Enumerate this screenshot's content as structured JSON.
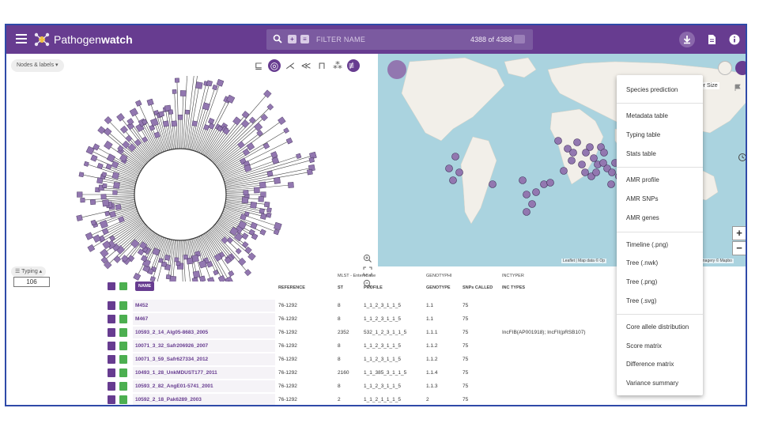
{
  "app": {
    "title_prefix": "Pathogen",
    "title_suffix": "watch"
  },
  "search": {
    "placeholder": "FILTER NAME",
    "count": "4388 of 4388"
  },
  "tree": {
    "nodes_labels": "Nodes & labels",
    "count_value": "106",
    "toolbar_icons": [
      "hierarchy-icon",
      "circular-tree-icon",
      "unrooted-tree-icon",
      "diagonal-tree-icon",
      "rectangular-tree-icon",
      "radial-tree-icon",
      "settings-toggle-icon"
    ]
  },
  "map": {
    "marker_size_label": "rker Size",
    "attribution_left": "Leaflet | Map data © Op",
    "attribution_right": "A, Imagery © Mapbo",
    "zoom_in": "+",
    "zoom_out": "−"
  },
  "table": {
    "typing_toggle": "Typing",
    "groups": {
      "mlst": "MLST - EnteroBase",
      "genotyphi": "GENOTYPHI",
      "inctyper": "INCTYPER"
    },
    "headers": {
      "name": "NAME",
      "reference": "REFERENCE",
      "st": "ST",
      "profile": "PROFILE",
      "genotype": "GENOTYPE",
      "snps_called": "SNPs CALLED",
      "inc_types": "INC TYPES"
    },
    "rows": [
      {
        "name": "M452",
        "reference": "76-1292",
        "st": "8",
        "profile": "1_1_2_3_1_1_5",
        "genotype": "1.1",
        "snps": "75",
        "inc": ""
      },
      {
        "name": "M467",
        "reference": "76-1292",
        "st": "8",
        "profile": "1_1_2_3_1_1_5",
        "genotype": "1.1",
        "snps": "75",
        "inc": ""
      },
      {
        "name": "10593_2_14_Alg05-8683_2005",
        "reference": "76-1292",
        "st": "2352",
        "profile": "532_1_2_3_1_1_5",
        "genotype": "1.1.1",
        "snps": "75",
        "inc": "IncFIB(AP001918); IncFII(pRSB107)"
      },
      {
        "name": "10071_3_32_Safr206926_2007",
        "reference": "76-1292",
        "st": "8",
        "profile": "1_1_2_3_1_1_5",
        "genotype": "1.1.2",
        "snps": "75",
        "inc": ""
      },
      {
        "name": "10071_3_59_Safr627334_2012",
        "reference": "76-1292",
        "st": "8",
        "profile": "1_1_2_3_1_1_5",
        "genotype": "1.1.2",
        "snps": "75",
        "inc": ""
      },
      {
        "name": "10493_1_28_UnkMDUST177_2011",
        "reference": "76-1292",
        "st": "2160",
        "profile": "1_1_385_3_1_1_5",
        "genotype": "1.1.4",
        "snps": "75",
        "inc": ""
      },
      {
        "name": "10593_2_82_AngE01-5741_2001",
        "reference": "76-1292",
        "st": "8",
        "profile": "1_1_2_3_1_1_5",
        "genotype": "1.1.3",
        "snps": "75",
        "inc": ""
      },
      {
        "name": "10592_2_18_Pak6289_2003",
        "reference": "76-1292",
        "st": "2",
        "profile": "1_1_2_1_1_1_5",
        "genotype": "2",
        "snps": "75",
        "inc": ""
      }
    ]
  },
  "dropdown": {
    "items": [
      "Species prediction",
      "Metadata table",
      "Typing table",
      "Stats table",
      "AMR profile",
      "AMR SNPs",
      "AMR genes",
      "Timeline (.png)",
      "Tree (.nwk)",
      "Tree (.png)",
      "Tree (.svg)",
      "Core allele distribution",
      "Score matrix",
      "Difference matrix",
      "Variance summary"
    ]
  },
  "colors": {
    "brand": "#673c90",
    "node": "#9277b0",
    "accent_green": "#4caf50"
  }
}
